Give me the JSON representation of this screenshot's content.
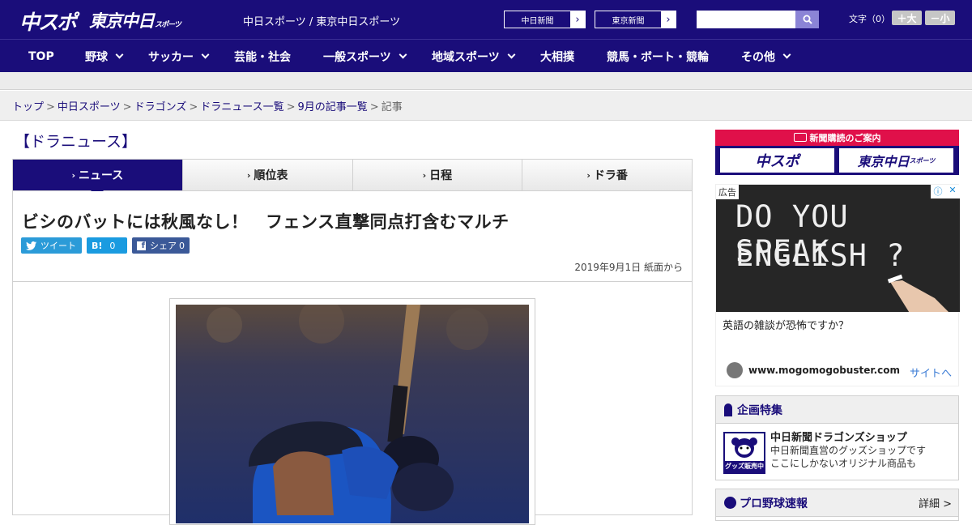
{
  "header": {
    "logo_chuspo": "中スポ",
    "logo_tokyo": "東京中日",
    "logo_tokyo_sub": "スポーツ",
    "site_name": "中日スポーツ / 東京中日スポーツ",
    "paper_links": [
      "中日新聞",
      "東京新聞"
    ],
    "search_placeholder": "",
    "font_size_label": "文字（0）",
    "font_bigger": "＋大",
    "font_smaller": "－小"
  },
  "nav": {
    "items": [
      {
        "label": "TOP",
        "dropdown": false
      },
      {
        "label": "野球",
        "dropdown": true
      },
      {
        "label": "サッカー",
        "dropdown": true
      },
      {
        "label": "芸能・社会",
        "dropdown": false
      },
      {
        "label": "一般スポーツ",
        "dropdown": true
      },
      {
        "label": "地域スポーツ",
        "dropdown": true
      },
      {
        "label": "大相撲",
        "dropdown": false
      },
      {
        "label": "競馬・ボート・競輪",
        "dropdown": false
      },
      {
        "label": "その他",
        "dropdown": true
      }
    ]
  },
  "breadcrumb": {
    "items": [
      "トップ",
      "中日スポーツ",
      "ドラゴンズ",
      "ドラニュース一覧",
      "9月の記事一覧"
    ],
    "current": "記事",
    "separator": ">"
  },
  "section": {
    "title": "【ドラニュース】",
    "tabs": [
      {
        "label": "ニュース",
        "active": true
      },
      {
        "label": "順位表",
        "active": false
      },
      {
        "label": "日程",
        "active": false
      },
      {
        "label": "ドラ番",
        "active": false
      }
    ]
  },
  "article": {
    "headline": "ビシのバットには秋風なし！　フェンス直撃同点打含むマルチ",
    "share": {
      "tweet": "ツイート",
      "hatena_label": "B!",
      "hatena_count": "0",
      "facebook_label": "シェア",
      "facebook_count": "0"
    },
    "date": "2019年9月1日 紙面から"
  },
  "sidebar": {
    "subscribe_label": "新聞購読のご案内",
    "subscribe_chuspo": "中スポ",
    "subscribe_tokyo": "東京中日",
    "subscribe_tokyo_sub": "スポーツ",
    "ad": {
      "label": "広告",
      "chalk_line1": "DO YOU SPEAK",
      "chalk_line2": "ENGLISH ?",
      "text": "英語の雑談が恐怖ですか？",
      "domain": "www.mogomogobuster.com",
      "site_link": "サイトへ"
    },
    "feature": {
      "heading": "企画特集",
      "title": "中日新聞ドラゴンズショップ",
      "desc_line1": "中日新聞直営のグッズショップです",
      "desc_line2": "ここにしかないオリジナル商品も",
      "badge_text": "グッズ販売中"
    },
    "baseball": {
      "heading": "プロ野球速報",
      "detail": "詳細 >"
    }
  }
}
